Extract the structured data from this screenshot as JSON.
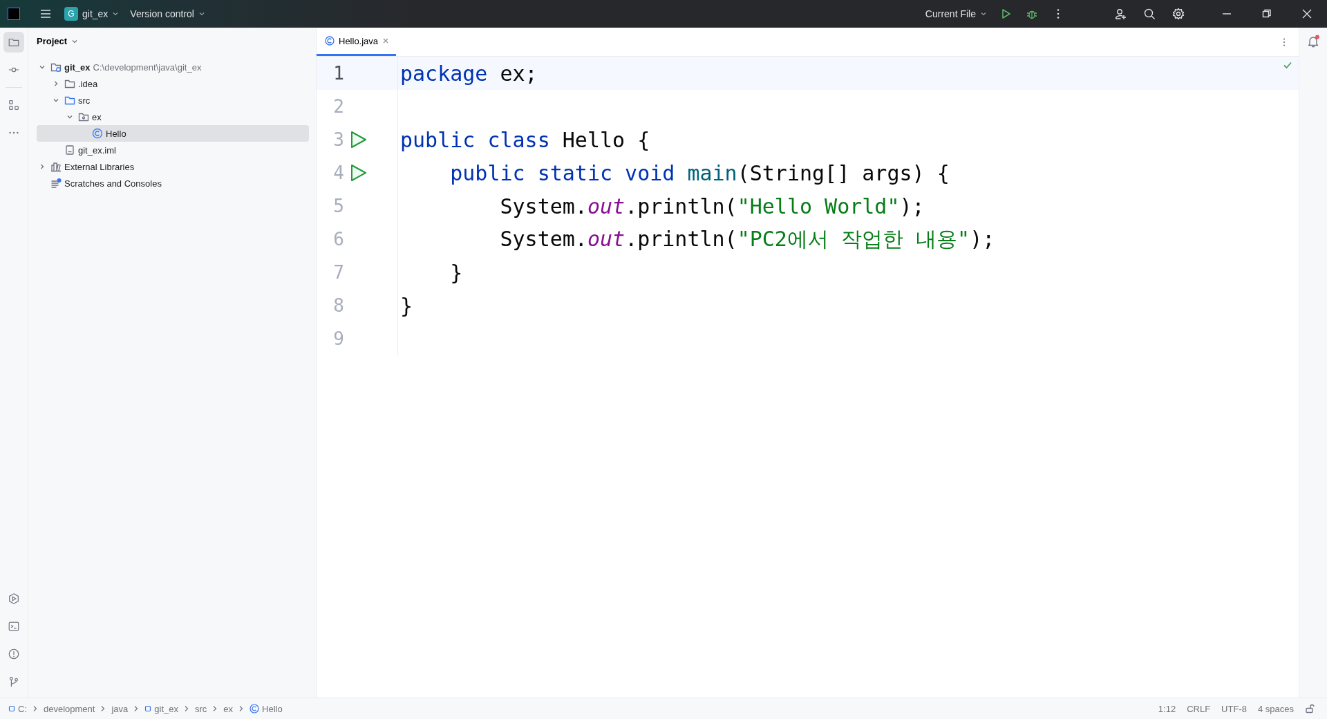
{
  "title_bar": {
    "project_badge": "G",
    "project_name": "git_ex",
    "vcs_label": "Version control",
    "run_config": "Current File"
  },
  "project_panel": {
    "title": "Project",
    "tree": [
      {
        "label": "git_ex",
        "path": "C:\\development\\java\\git_ex",
        "kind": "module",
        "expanded": true,
        "selected": false,
        "children": [
          {
            "label": ".idea",
            "kind": "folder",
            "expanded": false,
            "selected": false
          },
          {
            "label": "src",
            "kind": "source",
            "expanded": true,
            "selected": false,
            "children": [
              {
                "label": "ex",
                "kind": "package",
                "expanded": true,
                "selected": false,
                "children": [
                  {
                    "label": "Hello",
                    "kind": "class",
                    "selected": true
                  }
                ]
              }
            ]
          },
          {
            "label": "git_ex.iml",
            "kind": "file",
            "selected": false
          }
        ]
      },
      {
        "label": "External Libraries",
        "kind": "library",
        "expanded": false,
        "selected": false
      },
      {
        "label": "Scratches and Consoles",
        "kind": "scratches",
        "selected": false
      }
    ]
  },
  "editor": {
    "tabs": [
      {
        "label": "Hello.java",
        "selected": true
      }
    ],
    "lines": [
      {
        "number": "1",
        "current": true,
        "run": false,
        "tokens": [
          {
            "kind": "keyword",
            "text": "package"
          },
          {
            "kind": "plain",
            "text": " ex;"
          }
        ]
      },
      {
        "number": "2",
        "current": false,
        "run": false
      },
      {
        "number": "3",
        "current": false,
        "run": true,
        "tokens": [
          {
            "kind": "keyword",
            "text": "public class"
          },
          {
            "kind": "plain",
            "text": " Hello {"
          }
        ]
      },
      {
        "number": "4",
        "current": false,
        "run": true,
        "tokens": [
          {
            "kind": "keyword",
            "text": "    public static void "
          },
          {
            "kind": "method",
            "text": "main"
          },
          {
            "kind": "plain",
            "text": "(String[] args) {"
          }
        ]
      },
      {
        "number": "5",
        "current": false,
        "run": false,
        "tokens": [
          {
            "kind": "plain",
            "text": "        System."
          },
          {
            "kind": "field",
            "text": "out"
          },
          {
            "kind": "plain",
            "text": ".println("
          },
          {
            "kind": "string",
            "text": "\"Hello World\""
          },
          {
            "kind": "plain",
            "text": ");"
          }
        ]
      },
      {
        "number": "6",
        "current": false,
        "run": false,
        "tokens": [
          {
            "kind": "plain",
            "text": "        System."
          },
          {
            "kind": "field",
            "text": "out"
          },
          {
            "kind": "plain",
            "text": ".println("
          },
          {
            "kind": "string",
            "text": "\"PC2에서 작업한 내용\""
          },
          {
            "kind": "plain",
            "text": ");"
          }
        ]
      },
      {
        "number": "7",
        "current": false,
        "run": false,
        "tokens": [
          {
            "kind": "plain",
            "text": "    }"
          }
        ]
      },
      {
        "number": "8",
        "current": false,
        "run": false,
        "tokens": [
          {
            "kind": "plain",
            "text": "}"
          }
        ]
      },
      {
        "number": "9",
        "current": false,
        "run": false
      }
    ]
  },
  "notifications": {
    "unread": true
  },
  "status_bar": {
    "breadcrumbs": [
      {
        "kind": "drive",
        "label": "C:"
      },
      {
        "kind": "folder",
        "label": "development"
      },
      {
        "kind": "folder",
        "label": "java"
      },
      {
        "kind": "module",
        "label": "git_ex"
      },
      {
        "kind": "folder",
        "label": "src"
      },
      {
        "kind": "folder",
        "label": "ex"
      },
      {
        "kind": "class",
        "label": "Hello"
      }
    ],
    "items": [
      "1:12",
      "CRLF",
      "UTF-8",
      "4 spaces"
    ]
  }
}
